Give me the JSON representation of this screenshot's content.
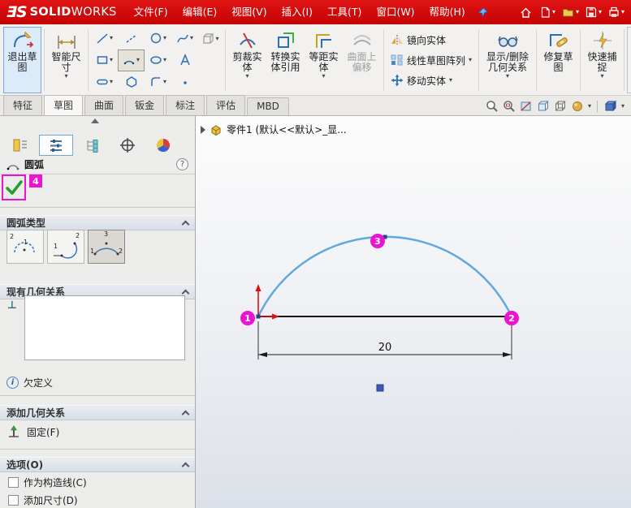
{
  "colors": {
    "menubar_red": "#cc0404",
    "annotation_magenta": "#ea14d2",
    "arc_blue": "#5fa8e0",
    "check_green": "#21a028",
    "selected_border": "#7da7d9"
  },
  "glyphs": {
    "dropdown": "▾"
  },
  "menubar": {
    "logo_ds": "ƎS",
    "logo_solid": "SOLID",
    "logo_works": "WORKS",
    "menus": [
      "文件(F)",
      "编辑(E)",
      "视图(V)",
      "插入(I)",
      "工具(T)",
      "窗口(W)",
      "帮助(H)"
    ]
  },
  "ribbon": {
    "exit_sketch": "退出草图",
    "smart_dimension": "智能尺寸",
    "trim_entities": "剪裁实体",
    "convert_entities": "转换实体引用",
    "offset_entities": "等距实体",
    "surface_offset": "曲面上偏移",
    "mirror_entities": "镜向实体",
    "linear_pattern": "线性草图阵列",
    "move_entities": "移动实体",
    "display_delete_relations": "显示/删除几何关系",
    "repair_sketch": "修复草图",
    "quick_snaps": "快速捕捉"
  },
  "tabs": {
    "items": [
      "特征",
      "草图",
      "曲面",
      "钣金",
      "标注",
      "评估",
      "MBD"
    ],
    "active": "草图"
  },
  "panel": {
    "title": "圆弧",
    "help": "?",
    "annotation_step": "4",
    "arc_type": {
      "header": "圆弧类型",
      "buttons": [
        {
          "digits": [
            "1",
            "2"
          ]
        },
        {
          "digits": [
            "1",
            "2"
          ]
        },
        {
          "digits": [
            "1",
            "2",
            "3"
          ]
        }
      ]
    },
    "existing_relations": {
      "header": "现有几何关系",
      "relation_glyph": "⊥"
    },
    "status": "欠定义",
    "status_icon": "i",
    "add_relations": {
      "header": "添加几何关系",
      "fixed": "固定(F)"
    },
    "options": {
      "header": "选项(O)",
      "construction": "作为构造线(C)",
      "add_dimension": "添加尺寸(D)"
    }
  },
  "viewport": {
    "breadcrumb": "零件1 (默认<<默认>_显...",
    "dimension": "20",
    "markers": [
      "1",
      "2",
      "3"
    ]
  }
}
